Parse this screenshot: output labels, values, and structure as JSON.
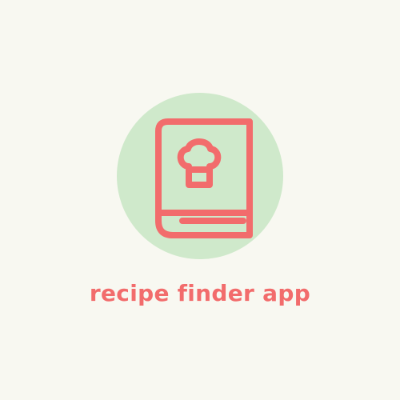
{
  "app": {
    "name": "recipe finder app"
  },
  "colors": {
    "background": "#f8f8f1",
    "circle": "#cfe9cb",
    "accent": "#f26c6c"
  },
  "icons": {
    "logo": "cookbook-chef-hat-icon"
  }
}
